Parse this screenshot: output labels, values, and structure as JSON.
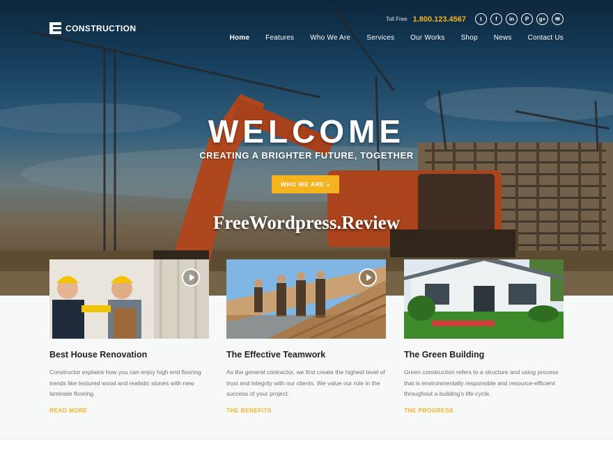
{
  "brand": {
    "logo_text": "CONSTRUCTION"
  },
  "topbar": {
    "tollfree_label": "Toll Free",
    "tollfree_number": "1.800.123.4567",
    "social_icons": [
      "twitter-icon",
      "facebook-icon",
      "linkedin-icon",
      "pinterest-icon",
      "google-plus-icon",
      "email-icon"
    ]
  },
  "nav": {
    "items": [
      {
        "label": "Home",
        "active": true
      },
      {
        "label": "Features"
      },
      {
        "label": "Who We Are"
      },
      {
        "label": "Services"
      },
      {
        "label": "Our Works"
      },
      {
        "label": "Shop"
      },
      {
        "label": "News"
      },
      {
        "label": "Contact Us"
      }
    ]
  },
  "hero": {
    "title": "WELCOME",
    "tagline": "CREATING A BRIGHTER FUTURE, TOGETHER",
    "cta_label": "WHO WE ARE »",
    "watermark": "FreeWordpress.Review"
  },
  "cards": [
    {
      "title": "Best House Renovation",
      "text": "Constructor explains how you can enjoy high end flooring trends like textured wood and realistic stones with new laminate flooring.",
      "link": "READ MORE",
      "has_play": true
    },
    {
      "title": "The Effective Teamwork",
      "text": "As the general contractor, we first create the highest level of trust and integrity with our clients. We value our role in the success of your project.",
      "link": "THE BENEFITS",
      "has_play": true
    },
    {
      "title": "The Green Building",
      "text": "Green construction refers to a structure and using process that is environmentally responsible and resource-efficient throughout a building's life-cycle.",
      "link": "THE PROGRESS",
      "has_play": false
    }
  ],
  "colors": {
    "accent": "#f5b320",
    "heading": "#222222",
    "body_text": "#6b6f73"
  }
}
